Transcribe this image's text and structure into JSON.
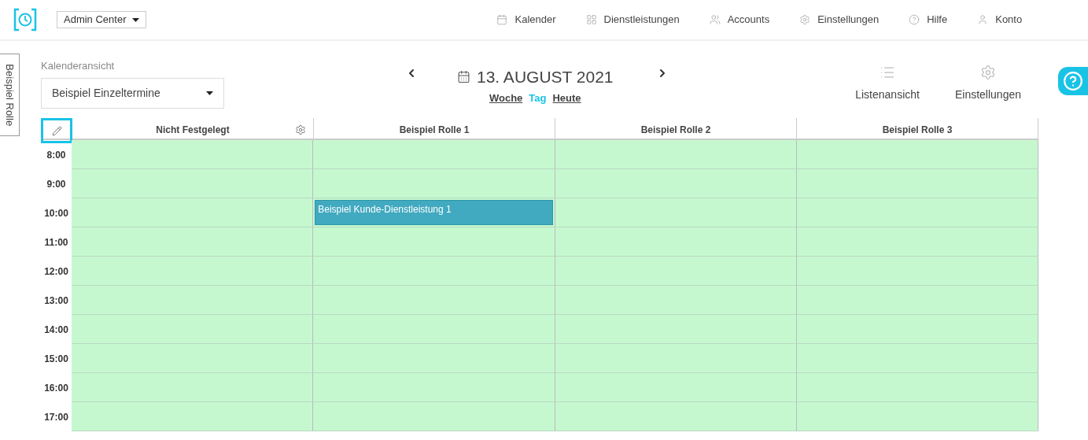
{
  "header": {
    "app_switch": "Admin Center",
    "nav": [
      {
        "label": "Kalender",
        "kind": "calendar"
      },
      {
        "label": "Dienstleistungen",
        "kind": "grid"
      },
      {
        "label": "Accounts",
        "kind": "users"
      },
      {
        "label": "Einstellungen",
        "kind": "gear"
      },
      {
        "label": "Hilfe",
        "kind": "help"
      },
      {
        "label": "Konto",
        "kind": "user"
      }
    ]
  },
  "side_tab": "Beispiel Rolle",
  "view_select": {
    "label": "Kalenderansicht",
    "value": "Beispiel Einzeltermine"
  },
  "date_nav": {
    "date": "13. AUGUST 2021",
    "modes": [
      {
        "label": "Woche",
        "selected": false
      },
      {
        "label": "Tag",
        "selected": true
      },
      {
        "label": "Heute",
        "selected": false
      }
    ]
  },
  "actions": [
    {
      "label": "Listenansicht",
      "kind": "list"
    },
    {
      "label": "Einstellungen",
      "kind": "gear"
    }
  ],
  "calendar": {
    "columns": [
      {
        "label": "Nicht Festgelegt",
        "settings": true
      },
      {
        "label": "Beispiel Rolle 1",
        "settings": false
      },
      {
        "label": "Beispiel Rolle 2",
        "settings": false
      },
      {
        "label": "Beispiel Rolle 3",
        "settings": false
      }
    ],
    "rows": [
      {
        "time": "8:00"
      },
      {
        "time": "9:00"
      },
      {
        "time": "10:00",
        "cells": [
          {
            "kind": "empty"
          },
          {
            "kind": "appointment",
            "title": "Beispiel Kunde-Dienstleistung 1"
          },
          {
            "kind": "empty"
          },
          {
            "kind": "empty"
          }
        ]
      },
      {
        "time": "11:00"
      },
      {
        "time": "12:00"
      },
      {
        "time": "13:00"
      },
      {
        "time": "14:00"
      },
      {
        "time": "15:00"
      },
      {
        "time": "16:00"
      },
      {
        "time": "17:00"
      }
    ]
  }
}
